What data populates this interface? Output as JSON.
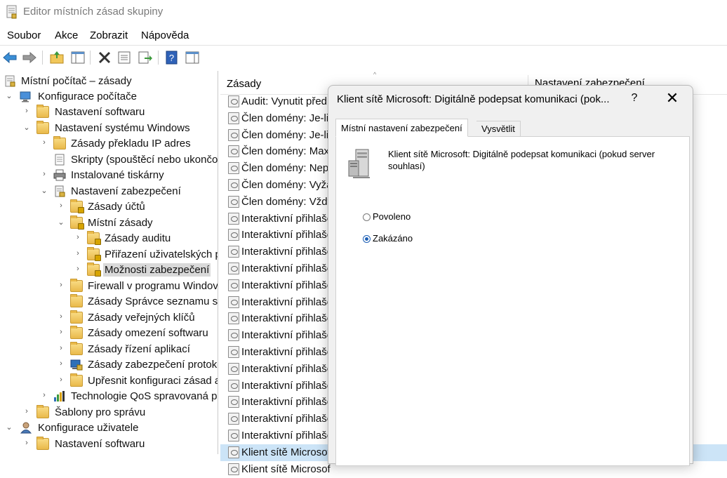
{
  "window": {
    "title": "Editor místních zásad skupiny"
  },
  "menu": [
    "Soubor",
    "Akce",
    "Zobrazit",
    "Nápověda"
  ],
  "toolbar": {
    "icons": [
      "back-arrow-icon",
      "forward-arrow-icon",
      "up-folder-icon",
      "show-hide-tree-icon",
      "delete-icon",
      "properties-icon",
      "export-list-icon",
      "help-icon",
      "show-hide-action-pane-icon"
    ]
  },
  "tree": {
    "items": [
      {
        "label": "Místní počítač – zásady"
      },
      {
        "label": "Konfigurace počítače"
      },
      {
        "label": "Nastavení softwaru"
      },
      {
        "label": "Nastavení systému Windows"
      },
      {
        "label": "Zásady překladu IP adres"
      },
      {
        "label": "Skripty (spouštěcí nebo ukončov"
      },
      {
        "label": "Instalované tiskárny"
      },
      {
        "label": "Nastavení zabezpečení"
      },
      {
        "label": "Zásady účtů"
      },
      {
        "label": "Místní zásady"
      },
      {
        "label": "Zásady auditu"
      },
      {
        "label": "Přiřazení uživatelských p"
      },
      {
        "label": "Možnosti zabezpečení"
      },
      {
        "label": "Firewall v programu Windov"
      },
      {
        "label": "Zásady Správce seznamu síti"
      },
      {
        "label": "Zásady veřejných klíčů"
      },
      {
        "label": "Zásady omezení softwaru"
      },
      {
        "label": "Zásady řízení aplikací"
      },
      {
        "label": "Zásady zabezpečení protoko"
      },
      {
        "label": "Upřesnit konfiguraci zásad a"
      },
      {
        "label": "Technologie QoS spravovaná po"
      },
      {
        "label": "Šablony pro správu"
      },
      {
        "label": "Konfigurace uživatele"
      },
      {
        "label": "Nastavení softwaru"
      }
    ]
  },
  "list": {
    "header_policy": "Zásady",
    "header_setting": "Nastavení zabezpečení",
    "sort_arrow": "^",
    "rows": [
      "Audit: Vynutit před",
      "Člen domény: Je-li",
      "Člen domény: Je-li",
      "Člen domény: Maxi",
      "Člen domény: Nepo",
      "Člen domény: Vyža",
      "Člen domény: Vždy",
      "Interaktivní přihlašo",
      "Interaktivní přihlašo",
      "Interaktivní přihlašo",
      "Interaktivní přihlašo",
      "Interaktivní přihlašo",
      "Interaktivní přihlašo",
      "Interaktivní přihlašo",
      "Interaktivní přihlašo",
      "Interaktivní přihlašo",
      "Interaktivní přihlašo",
      "Interaktivní přihlašo",
      "Interaktivní přihlašo",
      "Interaktivní přihlašo",
      "Interaktivní přihlašo",
      "Klient sítě Microsof",
      "Klient sítě Microsof"
    ]
  },
  "dialog": {
    "title": "Klient sítě Microsoft: Digitálně podepsat komunikaci (pok...",
    "help": "?",
    "close": "✕",
    "tab_local": "Místní nastavení zabezpečení",
    "tab_explain": "Vysvětlit",
    "policy_name": "Klient sítě Microsoft: Digitálně podepsat komunikaci (pokud server souhlasí)",
    "option_enabled": "Povoleno",
    "option_disabled": "Zakázáno",
    "selected_option": "Zakázáno"
  },
  "colors": {
    "selection_blue": "#cce4f7",
    "radio_blue": "#1c5fb5",
    "folder_yellow": "#e9b94a"
  }
}
